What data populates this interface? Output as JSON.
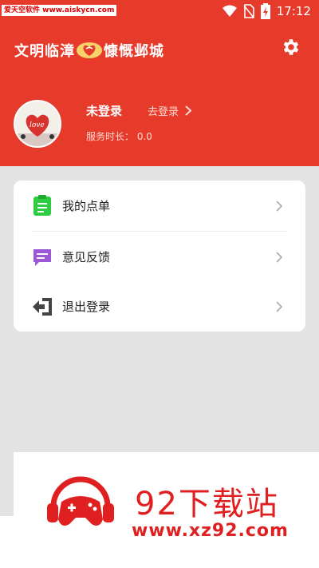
{
  "status_bar": {
    "watermark": "爱天空软件 www.aiskycn.com",
    "time": "17:12"
  },
  "header": {
    "title_left": "文明临漳",
    "title_right": "慷慨邺城",
    "accent_color": "#e63a2b",
    "settings_icon": "gear-icon"
  },
  "profile": {
    "avatar_text": "love",
    "name": "未登录",
    "login_label": "去登录",
    "service_time_label": "服务时长：",
    "service_time_value": "0.0"
  },
  "menu": {
    "items": [
      {
        "label": "我的点单",
        "icon": "clipboard-icon",
        "color": "#2ecc40"
      },
      {
        "label": "意见反馈",
        "icon": "feedback-icon",
        "color": "#9b59d6"
      },
      {
        "label": "退出登录",
        "icon": "logout-icon",
        "color": "#444444"
      }
    ]
  },
  "watermark": {
    "brand": "92下载站",
    "url": "www.xz92.com"
  }
}
